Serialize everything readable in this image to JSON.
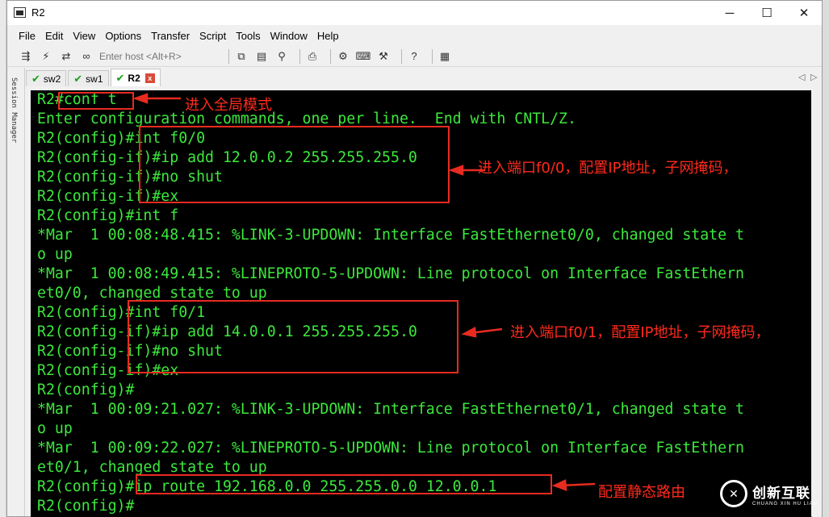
{
  "window": {
    "title": "R2",
    "minimize": "─",
    "maximize": "☐",
    "close": "✕"
  },
  "menu": [
    "File",
    "Edit",
    "View",
    "Options",
    "Transfer",
    "Script",
    "Tools",
    "Window",
    "Help"
  ],
  "toolbar": {
    "host_placeholder": "Enter host <Alt+R>",
    "icons": [
      "connect-icon",
      "quick-connect-icon",
      "reconnect-icon",
      "disconnect-icon",
      "copy-icon",
      "paste-icon",
      "find-icon",
      "print-icon",
      "settings-icon",
      "keymap-icon",
      "sftp-icon",
      "help-icon",
      "log-icon"
    ]
  },
  "session_manager": {
    "label": "Session Manager"
  },
  "tabs": [
    {
      "label": "sw2",
      "active": false
    },
    {
      "label": "sw1",
      "active": false
    },
    {
      "label": "R2",
      "active": true,
      "close": "x"
    }
  ],
  "tab_nav": {
    "prev": "◁",
    "next": "▷"
  },
  "terminal": {
    "lines": [
      "R2#conf t",
      "Enter configuration commands, one per line.  End with CNTL/Z.",
      "R2(config)#int f0/0",
      "R2(config-if)#ip add 12.0.0.2 255.255.255.0",
      "R2(config-if)#no shut",
      "R2(config-if)#ex",
      "R2(config)#int f",
      "*Mar  1 00:08:48.415: %LINK-3-UPDOWN: Interface FastEthernet0/0, changed state t",
      "o up",
      "*Mar  1 00:08:49.415: %LINEPROTO-5-UPDOWN: Line protocol on Interface FastEthern",
      "et0/0, changed state to up",
      "R2(config)#int f0/1",
      "R2(config-if)#ip add 14.0.0.1 255.255.255.0",
      "R2(config-if)#no shut",
      "R2(config-if)#ex",
      "R2(config)#",
      "*Mar  1 00:09:21.027: %LINK-3-UPDOWN: Interface FastEthernet0/1, changed state t",
      "o up",
      "*Mar  1 00:09:22.027: %LINEPROTO-5-UPDOWN: Line protocol on Interface FastEthern",
      "et0/1, changed state to up",
      "R2(config)#ip route 192.168.0.0 255.255.0.0 12.0.0.1",
      "R2(config)#"
    ]
  },
  "annotations": {
    "conf_t": "进入全局模式",
    "f0_0": "进入端口f0/0，配置IP地址，子网掩码，",
    "f0_1": "进入端口f0/1，配置IP地址，子网掩码，",
    "route": "配置静态路由"
  },
  "watermark": {
    "logo": "✕",
    "main": "创新互联",
    "sub": "CHUANG XIN HU LIAN"
  },
  "colors": {
    "terminal_text": "#3ce83c",
    "terminal_bg": "#000000",
    "annotation": "#e82b20"
  }
}
